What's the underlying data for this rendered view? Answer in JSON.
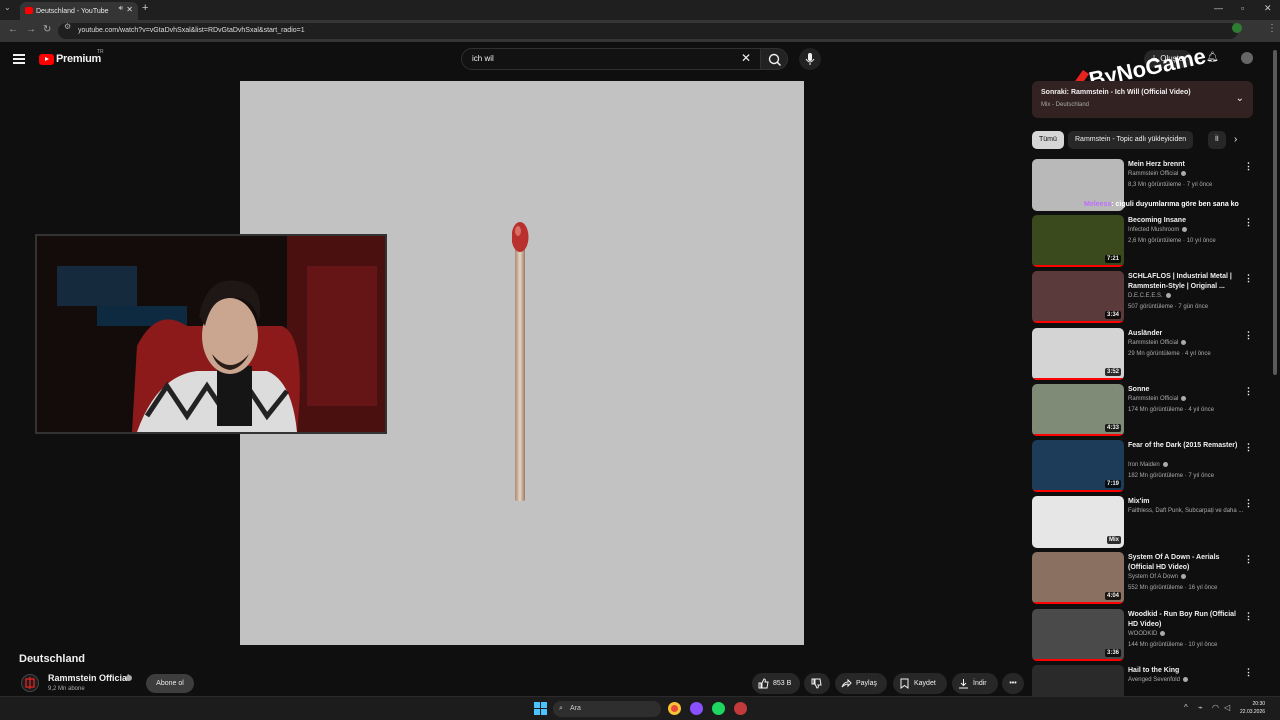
{
  "browser": {
    "tab_title": "Deutschland - YouTube",
    "url": "youtube.com/watch?v=vGtaDvhSxal&list=RDvGtaDvhSxal&start_radio=1"
  },
  "header": {
    "logo_text": "Premium",
    "logo_country": "TR",
    "search_value": "ich wil",
    "create_label": "Oluştur"
  },
  "watermark": {
    "text": "ByNoGame"
  },
  "video": {
    "title": "Deutschland",
    "channel": "Rammstein Official",
    "subscribers": "9,2 Mn abone",
    "subscribe_label": "Abone ol",
    "likes": "853 B",
    "share_label": "Paylaş",
    "save_label": "Kaydet",
    "download_label": "İndir"
  },
  "up_next": {
    "title": "Sonraki: Rammstein - Ich Will (Official Video)",
    "subtitle": "Mix - Deutschland"
  },
  "chips": [
    "Tümü",
    "Rammstein - Topic adlı yükleyiciden",
    "İl"
  ],
  "chat_overlay": {
    "user": "Meleess",
    "message": ": ciguli duyumlarıma göre ben sana ko"
  },
  "recommendations": [
    {
      "title": "Mein Herz brennt",
      "channel": "Rammstein Official",
      "meta": "8,3 Mn görüntüleme · 7 yıl önce",
      "duration": "",
      "thumb_color": "#b9b9b9"
    },
    {
      "title": "Becoming Insane",
      "channel": "Infected Mushroom",
      "meta": "2,6 Mn görüntüleme · 10 yıl önce",
      "duration": "7:21",
      "thumb_color": "#3b4a1c"
    },
    {
      "title": "SCHLAFLOS | Industrial Metal | Rammstein-Style | Original ...",
      "channel": "D.E.C.E.E.S.",
      "meta": "507 görüntüleme · 7 gün önce",
      "duration": "3:34",
      "thumb_color": "#5a3a3a"
    },
    {
      "title": "Ausländer",
      "channel": "Rammstein Official",
      "meta": "29 Mn görüntüleme · 4 yıl önce",
      "duration": "3:52",
      "thumb_color": "#d4d4d4"
    },
    {
      "title": "Sonne",
      "channel": "Rammstein Official",
      "meta": "174 Mn görüntüleme · 4 yıl önce",
      "duration": "4:33",
      "thumb_color": "#7f8b76"
    },
    {
      "title": "Fear of the Dark (2015 Remaster)",
      "channel": "Iron Maiden",
      "meta": "182 Mn görüntüleme · 7 yıl önce",
      "duration": "7:19",
      "thumb_color": "#1d3c5a"
    },
    {
      "title": "Mix'im",
      "channel": "Faithless, Daft Punk, Subcarpați ve daha ...",
      "meta": "",
      "duration": "Mix",
      "thumb_color": "#e6e6e6"
    },
    {
      "title": "System Of A Down - Aerials (Official HD Video)",
      "channel": "System Of A Down",
      "meta": "552 Mn görüntüleme · 16 yıl önce",
      "duration": "4:04",
      "thumb_color": "#8a7060"
    },
    {
      "title": "Woodkid - Run Boy Run (Official HD Video)",
      "channel": "WOODKID",
      "meta": "144 Mn görüntüleme · 10 yıl önce",
      "duration": "3:36",
      "thumb_color": "#4a4a4a"
    },
    {
      "title": "Hail to the King",
      "channel": "Avenged Sevenfold",
      "meta": "",
      "duration": "",
      "thumb_color": "#2a2a2a"
    }
  ],
  "taskbar": {
    "search_placeholder": "Ara",
    "time": "20:30",
    "date": "22.03.2026"
  }
}
